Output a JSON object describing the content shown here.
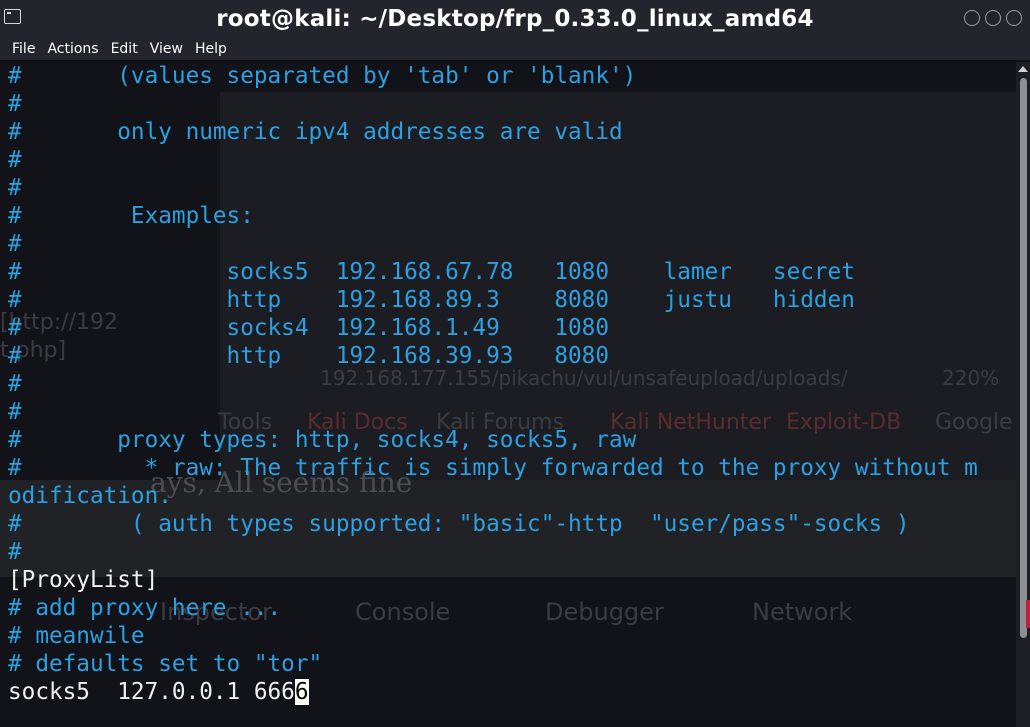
{
  "window": {
    "title": "root@kali: ~/Desktop/frp_0.33.0_linux_amd64"
  },
  "menu": {
    "items": [
      "File",
      "Actions",
      "Edit",
      "View",
      "Help"
    ]
  },
  "terminal": {
    "lines": [
      {
        "text": "#       (values separated by 'tab' or 'blank')",
        "style": "comment"
      },
      {
        "text": "#",
        "style": "comment"
      },
      {
        "text": "#       only numeric ipv4 addresses are valid",
        "style": "comment"
      },
      {
        "text": "#",
        "style": "comment"
      },
      {
        "text": "#",
        "style": "comment"
      },
      {
        "text": "#        Examples:",
        "style": "comment"
      },
      {
        "text": "#",
        "style": "comment"
      },
      {
        "text": "#               socks5  192.168.67.78   1080    lamer   secret",
        "style": "comment"
      },
      {
        "text": "#               http    192.168.89.3    8080    justu   hidden",
        "style": "comment"
      },
      {
        "text": "#               socks4  192.168.1.49    1080",
        "style": "comment"
      },
      {
        "text": "#               http    192.168.39.93   8080",
        "style": "comment"
      },
      {
        "text": "#",
        "style": "comment"
      },
      {
        "text": "#",
        "style": "comment"
      },
      {
        "text": "#       proxy types: http, socks4, socks5, raw",
        "style": "comment"
      },
      {
        "text": "#         * raw: The traffic is simply forwarded to the proxy without m",
        "style": "comment"
      },
      {
        "text": "odification.",
        "style": "comment"
      },
      {
        "text": "#        ( auth types supported: \"basic\"-http  \"user/pass\"-socks )",
        "style": "comment"
      },
      {
        "text": "#",
        "style": "comment"
      },
      {
        "text": "[ProxyList]",
        "style": "plain"
      },
      {
        "text": "# add proxy here ...",
        "style": "comment"
      },
      {
        "text": "# meanwile",
        "style": "comment"
      },
      {
        "text": "# defaults set to \"tor\"",
        "style": "comment"
      }
    ],
    "last_line": {
      "text_before_cursor": "socks5  127.0.0.1 666",
      "cursor_char": "6"
    }
  },
  "background_ghost": {
    "snippet_1": "  [http://192",
    "snippet_2": "t.php]",
    "url": "192.168.177.155/pikachu/vul/unsafeupload/uploads/",
    "zoom": "220%",
    "bookmarks": [
      "Tools",
      "Kali Docs",
      "Kali Forums",
      "Kali NetHunter",
      "Exploit-DB",
      "Google"
    ],
    "page_text": "ays,  All seems fine",
    "devtools_tabs": [
      "Inspector",
      "Console",
      "Debugger",
      "Network"
    ]
  }
}
